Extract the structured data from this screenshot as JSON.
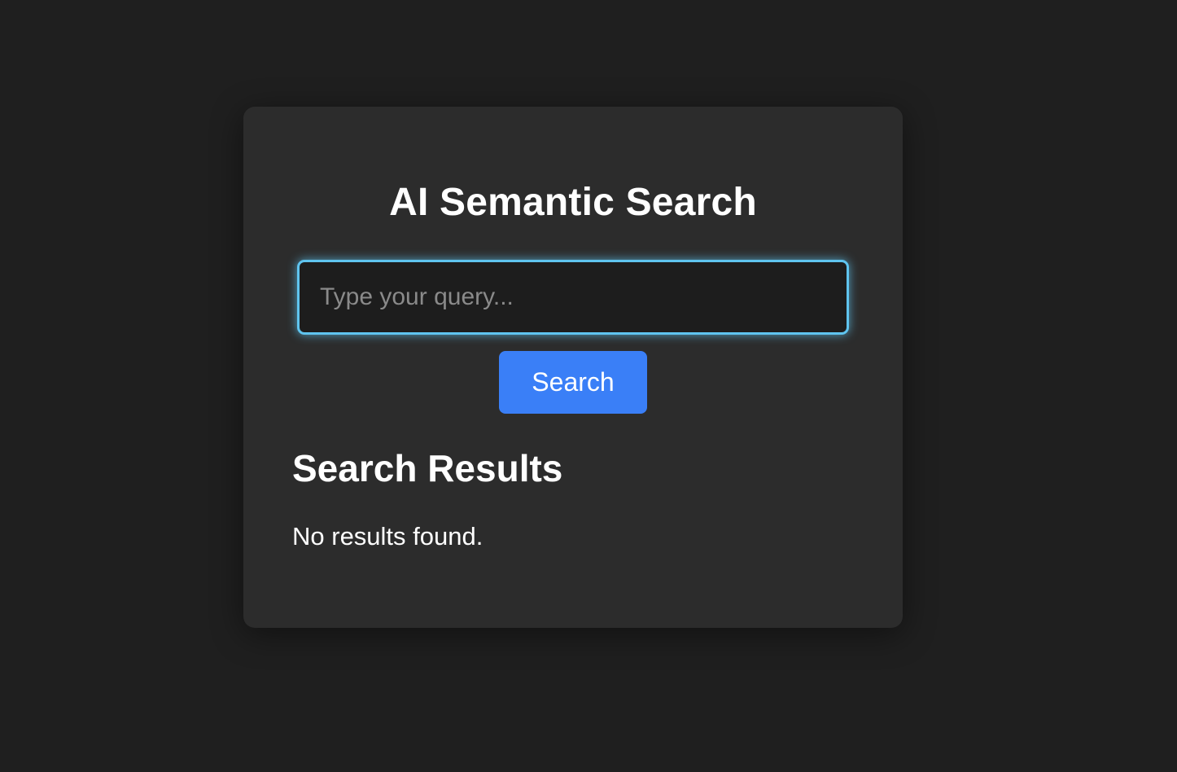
{
  "app": {
    "title": "AI Semantic Search"
  },
  "search": {
    "value": "",
    "placeholder": "Type your query...",
    "button_label": "Search"
  },
  "results": {
    "heading": "Search Results",
    "empty_message": "No results found."
  },
  "colors": {
    "page_background": "#1f1f1f",
    "card_background": "#2c2c2c",
    "input_focus_border": "#5fc4ef",
    "button_background": "#3a7ff7",
    "text": "#ffffff",
    "placeholder_text": "#8a8a8a"
  }
}
